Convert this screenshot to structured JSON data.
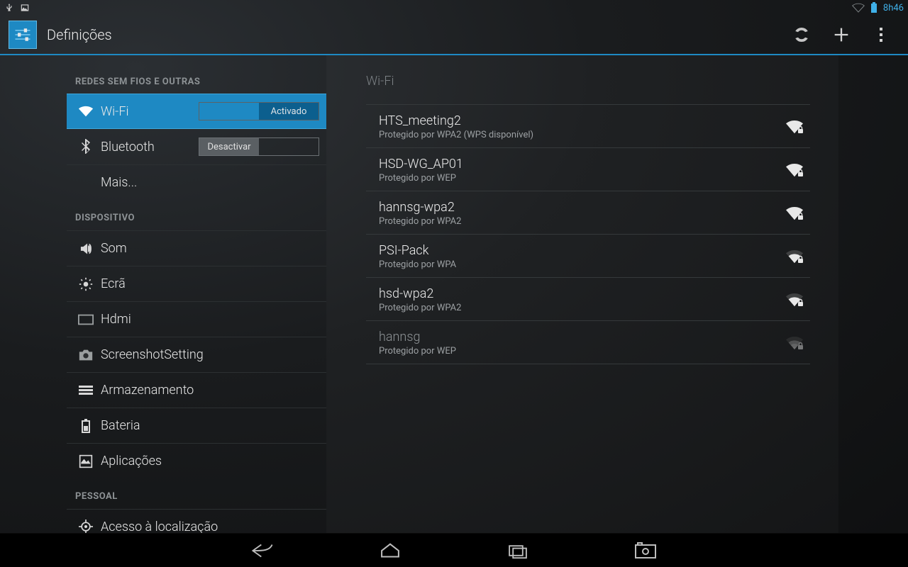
{
  "status": {
    "clock": "8h46"
  },
  "header": {
    "title": "Definições"
  },
  "sidebar": {
    "section_wireless": "REDES SEM FIOS E OUTRAS",
    "wifi": {
      "label": "Wi-Fi",
      "toggle_on": "Activado"
    },
    "bluetooth": {
      "label": "Bluetooth",
      "toggle_off": "Desactivar"
    },
    "more": {
      "label": "Mais..."
    },
    "section_device": "DISPOSITIVO",
    "sound": {
      "label": "Som"
    },
    "display": {
      "label": "Ecrã"
    },
    "hdmi": {
      "label": "Hdmi"
    },
    "screenshot": {
      "label": "ScreenshotSetting"
    },
    "storage": {
      "label": "Armazenamento"
    },
    "battery": {
      "label": "Bateria"
    },
    "apps": {
      "label": "Aplicações"
    },
    "section_personal": "PESSOAL",
    "location": {
      "label": "Acesso à localização"
    }
  },
  "detail": {
    "title": "Wi-Fi",
    "networks": [
      {
        "ssid": "HTS_meeting2",
        "security": "Protegido por WPA2 (WPS disponível)",
        "strength": 4,
        "locked": true
      },
      {
        "ssid": "HSD-WG_AP01",
        "security": "Protegido por WEP",
        "strength": 4,
        "locked": true
      },
      {
        "ssid": "hannsg-wpa2",
        "security": "Protegido por WPA2",
        "strength": 4,
        "locked": true
      },
      {
        "ssid": "PSI-Pack",
        "security": "Protegido por WPA",
        "strength": 3,
        "locked": true
      },
      {
        "ssid": "hsd-wpa2",
        "security": "Protegido por WPA2",
        "strength": 3,
        "locked": true
      },
      {
        "ssid": "hannsg",
        "security": "Protegido por WEP",
        "strength": 3,
        "locked": true,
        "dim": true
      }
    ]
  }
}
